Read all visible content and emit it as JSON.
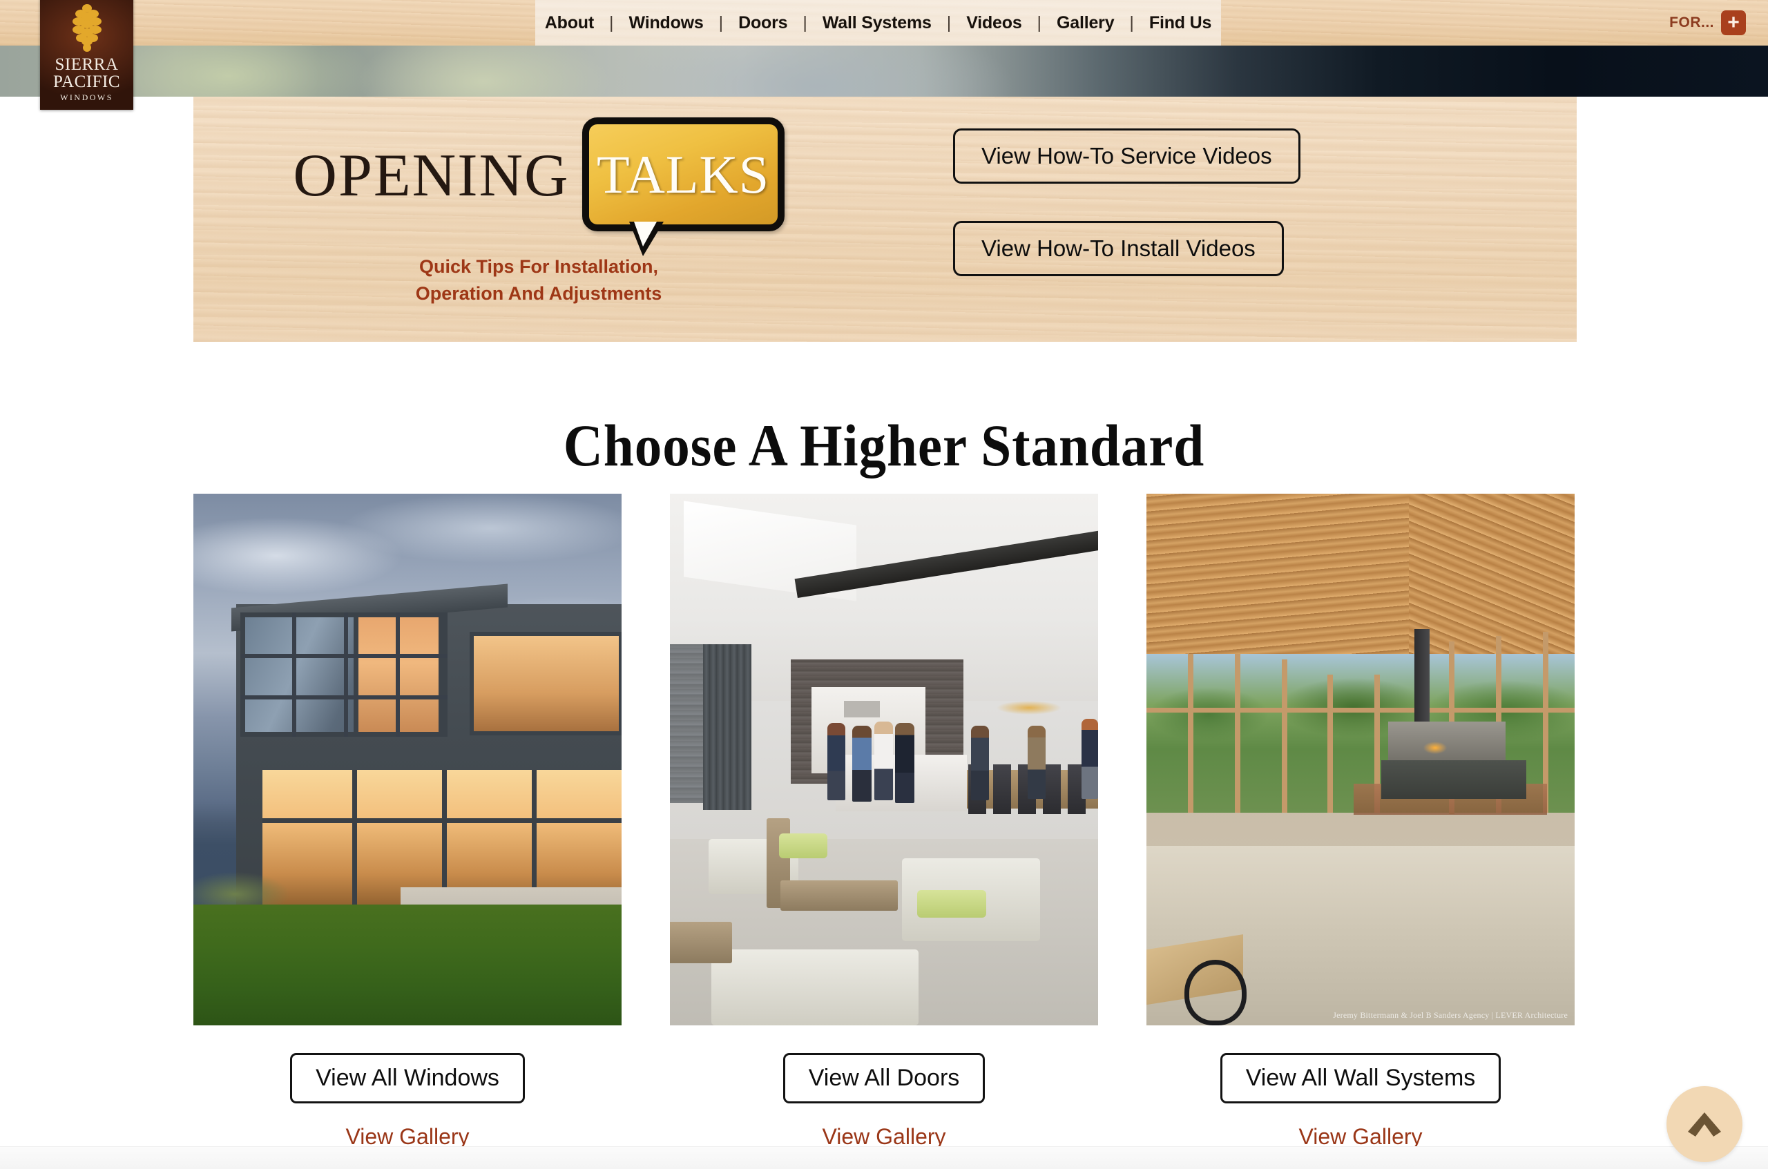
{
  "brand": {
    "logo_line1": "SIERRA",
    "logo_line2": "PACIFIC",
    "logo_line3": "WINDOWS",
    "logo_icon": "pinecone-icon",
    "logo_bg": "#4c2111",
    "logo_accent": "#e0a72c"
  },
  "nav": {
    "items": [
      {
        "label": "About"
      },
      {
        "label": "Windows"
      },
      {
        "label": "Doors"
      },
      {
        "label": "Wall Systems"
      },
      {
        "label": "Videos"
      },
      {
        "label": "Gallery"
      },
      {
        "label": "Find Us"
      }
    ],
    "separator": "|",
    "for_label": "FOR...",
    "for_plus": "+",
    "for_color": "#a9401d"
  },
  "opening_talks": {
    "word_opening": "OPENING",
    "word_talks": "TALKS",
    "tagline_line1": "Quick Tips For Installation,",
    "tagline_line2": "Operation And Adjustments",
    "tagline_color": "#9e3716",
    "bubble_color": "#e8b336",
    "buttons": [
      {
        "label": "View How-To Service Videos"
      },
      {
        "label": "View How-To Install Videos"
      }
    ]
  },
  "main": {
    "heading": "Choose A Higher Standard",
    "cards": [
      {
        "image_name": "modern-house-dusk-photo",
        "button_label": "View All Windows",
        "link_label": "View Gallery",
        "credit": ""
      },
      {
        "image_name": "open-plan-kitchen-gathering-photo",
        "button_label": "View All Doors",
        "link_label": "View Gallery",
        "credit": ""
      },
      {
        "image_name": "wood-ceiling-great-room-photo",
        "button_label": "View All Wall Systems",
        "link_label": "View Gallery",
        "credit": "Jeremy Bittermann & Joel B Sanders Agency | LEVER Architecture"
      }
    ]
  },
  "scroll_top": {
    "icon": "chevron-up-icon",
    "bg": "#f2d8b4",
    "arrow_color": "#6b5434"
  }
}
